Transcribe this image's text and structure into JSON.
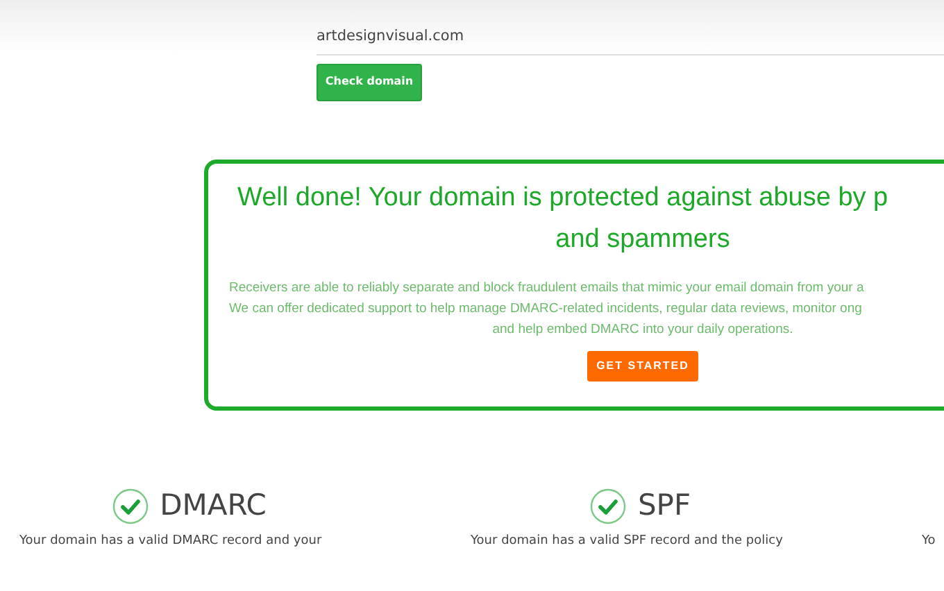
{
  "domain_form": {
    "value": "artdesignvisual.com",
    "button": "Check domain"
  },
  "result": {
    "title": "Well done! Your domain is protected against abuse by p",
    "title_line_2": "and spammers",
    "lines": [
      "Receivers are able to reliably separate and block fraudulent emails that mimic your email domain from your a",
      "We can offer dedicated support to help manage DMARC-related incidents, regular data reviews, monitor ong",
      "and help embed DMARC into your daily operations."
    ],
    "button": "GET STARTED"
  },
  "checks": [
    {
      "title": "DMARC",
      "valid": true,
      "text": "Your domain has a valid DMARC record and your"
    },
    {
      "title": "SPF",
      "valid": true,
      "text": "Your domain has a valid SPF record and the policy"
    },
    {
      "text": "Yo"
    }
  ]
}
